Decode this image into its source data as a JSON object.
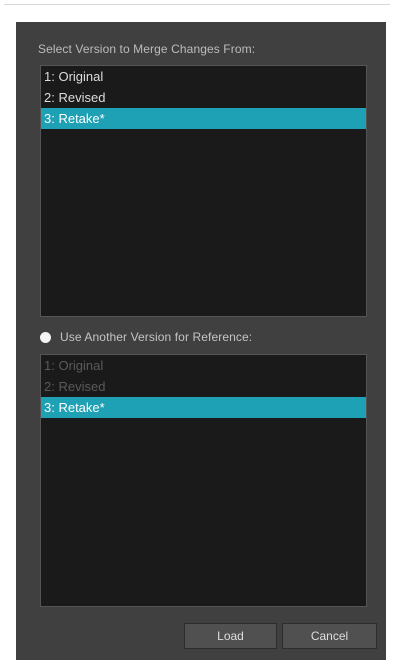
{
  "merge_section": {
    "label": "Select Version to Merge Changes From:",
    "versions": [
      {
        "label": "1: Original",
        "selected": false,
        "enabled": true
      },
      {
        "label": "2: Revised",
        "selected": false,
        "enabled": true
      },
      {
        "label": "3: Retake*",
        "selected": true,
        "enabled": true
      }
    ]
  },
  "reference_section": {
    "radio_label": "Use Another Version for Reference:",
    "radio_checked": false,
    "versions": [
      {
        "label": "1: Original",
        "selected": false,
        "enabled": false
      },
      {
        "label": "2: Revised",
        "selected": false,
        "enabled": false
      },
      {
        "label": "3: Retake*",
        "selected": true,
        "enabled": true
      }
    ]
  },
  "buttons": {
    "load_label": "Load",
    "cancel_label": "Cancel"
  },
  "colors": {
    "dialog_background": "#404040",
    "list_background": "#1a1a1a",
    "selection_highlight": "#1ea1b4"
  }
}
